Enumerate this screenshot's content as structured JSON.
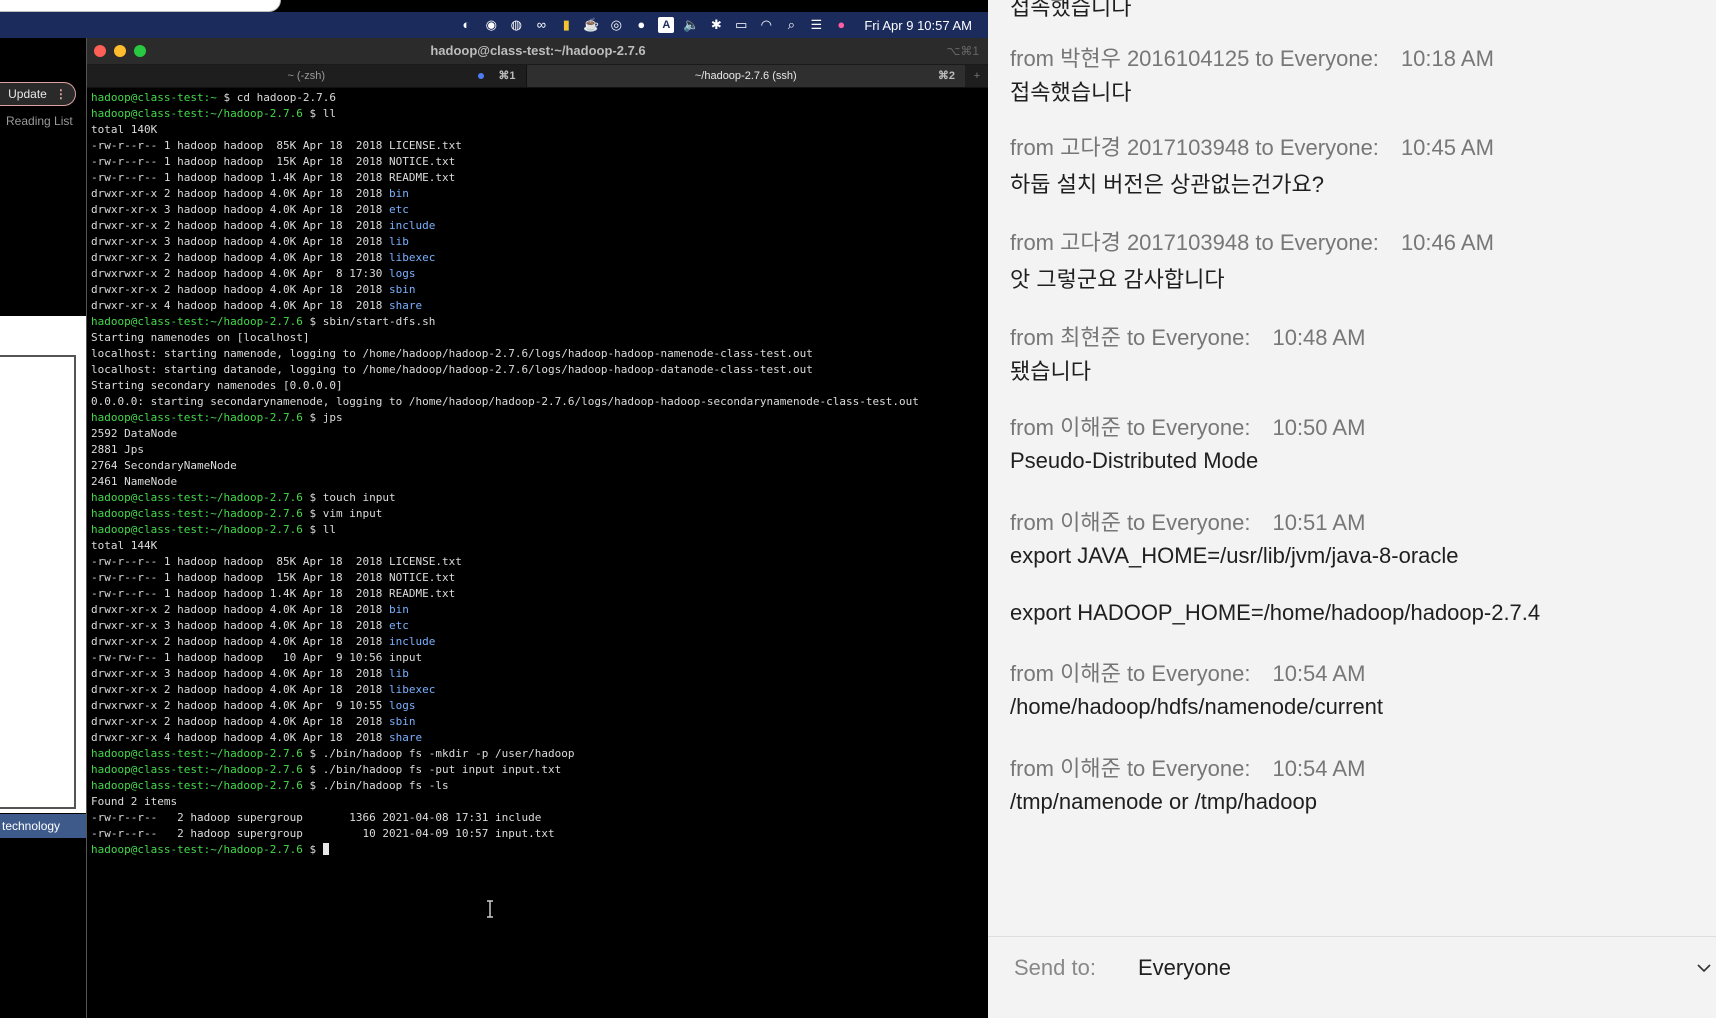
{
  "menubar": {
    "clock": "Fri Apr 9  10:57 AM",
    "icons": [
      "messenger-icon",
      "shield-icon",
      "chat-bubble-icon",
      "glasses-icon",
      "bookmark-icon",
      "coffee-icon",
      "creative-cloud-icon",
      "sync-icon",
      "text-input-icon",
      "volume-icon",
      "bluetooth-icon",
      "battery-icon",
      "wifi-icon",
      "spotlight-icon",
      "control-center-icon",
      "siri-icon"
    ]
  },
  "browser": {
    "update_label": "Update",
    "reading_list_label": "Reading List",
    "tech_label": "technology"
  },
  "terminal": {
    "title": "hadoop@class-test:~/hadoop-2.7.6",
    "title_shortcut": "⌥⌘1",
    "tabs": [
      {
        "label": "~ (-zsh)",
        "shortcut": "⌘1"
      },
      {
        "label": "~/hadoop-2.7.6 (ssh)",
        "shortcut": "⌘2"
      }
    ],
    "tab_add": "+",
    "prompt_home": "hadoop@class-test:~",
    "prompt_dir": "hadoop@class-test:~/hadoop-2.7.6",
    "lines": [
      {
        "kind": "prompt",
        "p": "hadoop@class-test:~",
        "c": " $ cd hadoop-2.7.6"
      },
      {
        "kind": "prompt",
        "p": "hadoop@class-test:~/hadoop-2.7.6",
        "c": " $ ll"
      },
      {
        "kind": "out",
        "t": "total 140K"
      },
      {
        "kind": "ls",
        "t": "-rw-r--r-- 1 hadoop hadoop  85K Apr 18  2018 ",
        "n": "LICENSE.txt",
        "dir": false
      },
      {
        "kind": "ls",
        "t": "-rw-r--r-- 1 hadoop hadoop  15K Apr 18  2018 ",
        "n": "NOTICE.txt",
        "dir": false
      },
      {
        "kind": "ls",
        "t": "-rw-r--r-- 1 hadoop hadoop 1.4K Apr 18  2018 ",
        "n": "README.txt",
        "dir": false
      },
      {
        "kind": "ls",
        "t": "drwxr-xr-x 2 hadoop hadoop 4.0K Apr 18  2018 ",
        "n": "bin",
        "dir": true
      },
      {
        "kind": "ls",
        "t": "drwxr-xr-x 3 hadoop hadoop 4.0K Apr 18  2018 ",
        "n": "etc",
        "dir": true
      },
      {
        "kind": "ls",
        "t": "drwxr-xr-x 2 hadoop hadoop 4.0K Apr 18  2018 ",
        "n": "include",
        "dir": true
      },
      {
        "kind": "ls",
        "t": "drwxr-xr-x 3 hadoop hadoop 4.0K Apr 18  2018 ",
        "n": "lib",
        "dir": true
      },
      {
        "kind": "ls",
        "t": "drwxr-xr-x 2 hadoop hadoop 4.0K Apr 18  2018 ",
        "n": "libexec",
        "dir": true
      },
      {
        "kind": "ls",
        "t": "drwxrwxr-x 2 hadoop hadoop 4.0K Apr  8 17:30 ",
        "n": "logs",
        "dir": true
      },
      {
        "kind": "ls",
        "t": "drwxr-xr-x 2 hadoop hadoop 4.0K Apr 18  2018 ",
        "n": "sbin",
        "dir": true
      },
      {
        "kind": "ls",
        "t": "drwxr-xr-x 4 hadoop hadoop 4.0K Apr 18  2018 ",
        "n": "share",
        "dir": true
      },
      {
        "kind": "prompt",
        "p": "hadoop@class-test:~/hadoop-2.7.6",
        "c": " $ sbin/start-dfs.sh"
      },
      {
        "kind": "out",
        "t": "Starting namenodes on [localhost]"
      },
      {
        "kind": "out",
        "t": "localhost: starting namenode, logging to /home/hadoop/hadoop-2.7.6/logs/hadoop-hadoop-namenode-class-test.out"
      },
      {
        "kind": "out",
        "t": "localhost: starting datanode, logging to /home/hadoop/hadoop-2.7.6/logs/hadoop-hadoop-datanode-class-test.out"
      },
      {
        "kind": "out",
        "t": "Starting secondary namenodes [0.0.0.0]"
      },
      {
        "kind": "out",
        "t": "0.0.0.0: starting secondarynamenode, logging to /home/hadoop/hadoop-2.7.6/logs/hadoop-hadoop-secondarynamenode-class-test.out"
      },
      {
        "kind": "prompt",
        "p": "hadoop@class-test:~/hadoop-2.7.6",
        "c": " $ jps"
      },
      {
        "kind": "out",
        "t": "2592 DataNode"
      },
      {
        "kind": "out",
        "t": "2881 Jps"
      },
      {
        "kind": "out",
        "t": "2764 SecondaryNameNode"
      },
      {
        "kind": "out",
        "t": "2461 NameNode"
      },
      {
        "kind": "prompt",
        "p": "hadoop@class-test:~/hadoop-2.7.6",
        "c": " $ touch input"
      },
      {
        "kind": "prompt",
        "p": "hadoop@class-test:~/hadoop-2.7.6",
        "c": " $ vim input"
      },
      {
        "kind": "prompt",
        "p": "hadoop@class-test:~/hadoop-2.7.6",
        "c": " $ ll"
      },
      {
        "kind": "out",
        "t": "total 144K"
      },
      {
        "kind": "ls",
        "t": "-rw-r--r-- 1 hadoop hadoop  85K Apr 18  2018 ",
        "n": "LICENSE.txt",
        "dir": false
      },
      {
        "kind": "ls",
        "t": "-rw-r--r-- 1 hadoop hadoop  15K Apr 18  2018 ",
        "n": "NOTICE.txt",
        "dir": false
      },
      {
        "kind": "ls",
        "t": "-rw-r--r-- 1 hadoop hadoop 1.4K Apr 18  2018 ",
        "n": "README.txt",
        "dir": false
      },
      {
        "kind": "ls",
        "t": "drwxr-xr-x 2 hadoop hadoop 4.0K Apr 18  2018 ",
        "n": "bin",
        "dir": true
      },
      {
        "kind": "ls",
        "t": "drwxr-xr-x 3 hadoop hadoop 4.0K Apr 18  2018 ",
        "n": "etc",
        "dir": true
      },
      {
        "kind": "ls",
        "t": "drwxr-xr-x 2 hadoop hadoop 4.0K Apr 18  2018 ",
        "n": "include",
        "dir": true
      },
      {
        "kind": "ls",
        "t": "-rw-rw-r-- 1 hadoop hadoop   10 Apr  9 10:56 ",
        "n": "input",
        "dir": false
      },
      {
        "kind": "ls",
        "t": "drwxr-xr-x 3 hadoop hadoop 4.0K Apr 18  2018 ",
        "n": "lib",
        "dir": true
      },
      {
        "kind": "ls",
        "t": "drwxr-xr-x 2 hadoop hadoop 4.0K Apr 18  2018 ",
        "n": "libexec",
        "dir": true
      },
      {
        "kind": "ls",
        "t": "drwxrwxr-x 2 hadoop hadoop 4.0K Apr  9 10:55 ",
        "n": "logs",
        "dir": true
      },
      {
        "kind": "ls",
        "t": "drwxr-xr-x 2 hadoop hadoop 4.0K Apr 18  2018 ",
        "n": "sbin",
        "dir": true
      },
      {
        "kind": "ls",
        "t": "drwxr-xr-x 4 hadoop hadoop 4.0K Apr 18  2018 ",
        "n": "share",
        "dir": true
      },
      {
        "kind": "prompt",
        "p": "hadoop@class-test:~/hadoop-2.7.6",
        "c": " $ ./bin/hadoop fs -mkdir -p /user/hadoop"
      },
      {
        "kind": "prompt",
        "p": "hadoop@class-test:~/hadoop-2.7.6",
        "c": " $ ./bin/hadoop fs -put input input.txt"
      },
      {
        "kind": "prompt",
        "p": "hadoop@class-test:~/hadoop-2.7.6",
        "c": " $ ./bin/hadoop fs -ls"
      },
      {
        "kind": "out",
        "t": "Found 2 items"
      },
      {
        "kind": "out",
        "t": "-rw-r--r--   2 hadoop supergroup       1366 2021-04-08 17:31 include"
      },
      {
        "kind": "out",
        "t": "-rw-r--r--   2 hadoop supergroup         10 2021-04-09 10:57 input.txt"
      },
      {
        "kind": "cursor",
        "p": "hadoop@class-test:~/hadoop-2.7.6",
        "c": " $ "
      }
    ]
  },
  "chat": {
    "top_partial": "접속했습니다",
    "messages": [
      {
        "from": "from 박현우 2016104125 to Everyone:",
        "time": "10:18  AM",
        "texts": [
          "접속했습니다"
        ]
      },
      {
        "from": "from 고다경 2017103948 to Everyone:",
        "time": "10:45  AM",
        "texts": [
          "하둡 설치 버전은 상관없는건가요?"
        ]
      },
      {
        "from": "from 고다경 2017103948 to Everyone:",
        "time": "10:46  AM",
        "texts": [
          "앗 그렇군요 감사합니다"
        ]
      },
      {
        "from": "from 최현준 to Everyone:",
        "time": "10:48  AM",
        "texts": [
          "됐습니다"
        ]
      },
      {
        "from": "from 이해준 to Everyone:",
        "time": "10:50  AM",
        "texts": [
          "Pseudo-Distributed Mode"
        ]
      },
      {
        "from": "from 이해준 to Everyone:",
        "time": "10:51  AM",
        "texts": [
          "export JAVA_HOME=/usr/lib/jvm/java-8-oracle",
          "export HADOOP_HOME=/home/hadoop/hadoop-2.7.4"
        ]
      },
      {
        "from": "from 이해준 to Everyone:",
        "time": "10:54  AM",
        "texts": [
          "/home/hadoop/hdfs/namenode/current"
        ]
      },
      {
        "from": "from 이해준 to Everyone:",
        "time": "10:54  AM",
        "texts": [
          "/tmp/namenode or /tmp/hadoop"
        ]
      }
    ],
    "send_to_label": "Send to:",
    "send_to_value": "Everyone"
  }
}
